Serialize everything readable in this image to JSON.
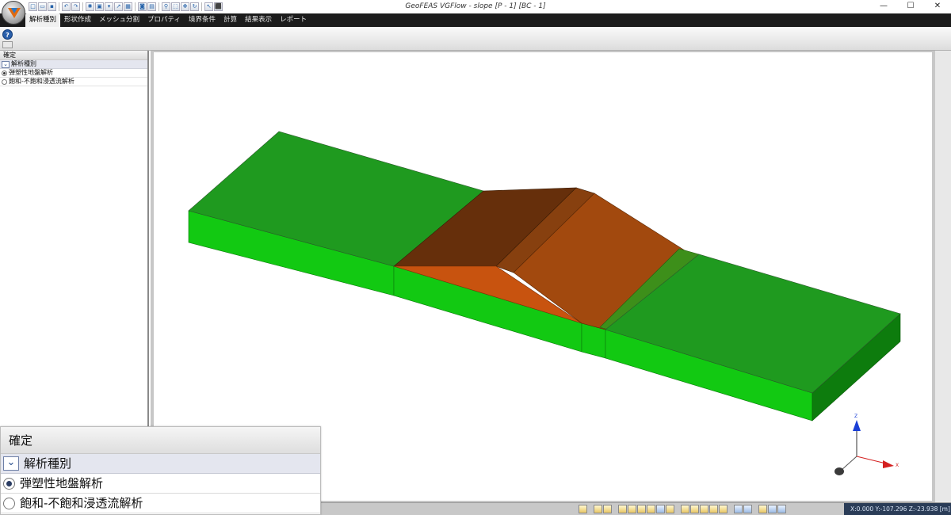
{
  "window": {
    "title": "GeoFEAS VGFlow - slope [P - 1] [BC - 1]",
    "controls": {
      "minimize": "—",
      "maximize": "☐",
      "close": "✕"
    }
  },
  "ribbon": {
    "tabs": [
      {
        "label": "解析種別",
        "active": true
      },
      {
        "label": "形状作成",
        "active": false
      },
      {
        "label": "メッシュ分割",
        "active": false
      },
      {
        "label": "プロパティ",
        "active": false
      },
      {
        "label": "境界条件",
        "active": false
      },
      {
        "label": "計算",
        "active": false
      },
      {
        "label": "結果表示",
        "active": false
      },
      {
        "label": "レポート",
        "active": false
      }
    ],
    "help_label": "?"
  },
  "panel": {
    "confirm_label": "確定",
    "group_label": "解析種別",
    "options": [
      {
        "label": "弾塑性地盤解析",
        "selected": true
      },
      {
        "label": "飽和-不飽和浸透流解析",
        "selected": false
      }
    ]
  },
  "axes": {
    "z_label": "Z",
    "x_label": "X"
  },
  "status": {
    "coords": "X:0.000 Y:-107.296 Z:-23.938 [m]"
  },
  "colors": {
    "ground_top": "#1f9a1f",
    "ground_side": "#12c912",
    "embankment_top": "#a2490e",
    "embankment_dark": "#662f0b",
    "embankment_face": "#c8530f"
  }
}
